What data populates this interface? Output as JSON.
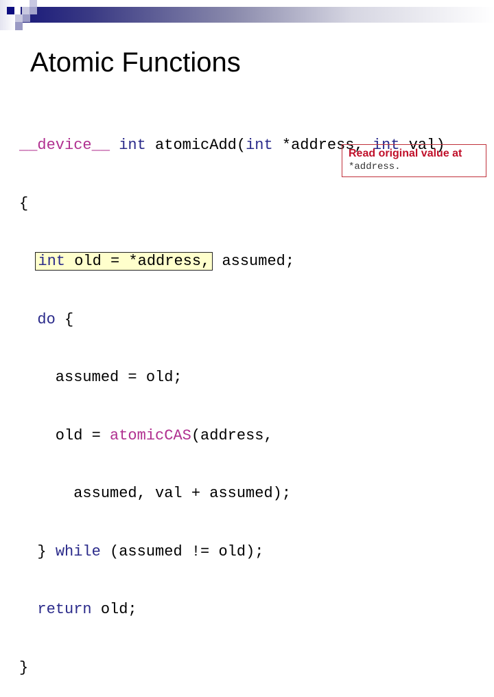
{
  "slide": {
    "title": "Atomic Functions",
    "colors": {
      "keyword": "#2a2a8a",
      "qualifier": "#b03090",
      "highlight_bg": "#ffffcc",
      "note_border": "#c0303a",
      "note_title": "#c0102a"
    }
  },
  "code": {
    "line1": {
      "qualifier": "__device__",
      "sp1": " ",
      "kw1": "int",
      "rest1": " atomicAdd(",
      "kw2": "int",
      "rest2": " *address, ",
      "kw3": "int",
      "rest3": " val)"
    },
    "line2": "{",
    "line3": {
      "indent": "  ",
      "kw": "int",
      "highlighted": " old = *address,",
      "rest": " assumed;"
    },
    "line4": {
      "indent": "  ",
      "kw": "do",
      "rest": " {"
    },
    "line5": "    assumed = old;",
    "line6": {
      "pre": "    old = ",
      "fn": "atomicCAS",
      "rest": "(address,"
    },
    "line7": "      assumed, val + assumed);",
    "line8": {
      "pre": "  } ",
      "kw": "while",
      "rest": " (assumed != old);"
    },
    "line9": {
      "indent": "  ",
      "kw": "return",
      "rest": " old;"
    },
    "line10": "}"
  },
  "note": {
    "title": "Read original value at",
    "code": "*address."
  }
}
